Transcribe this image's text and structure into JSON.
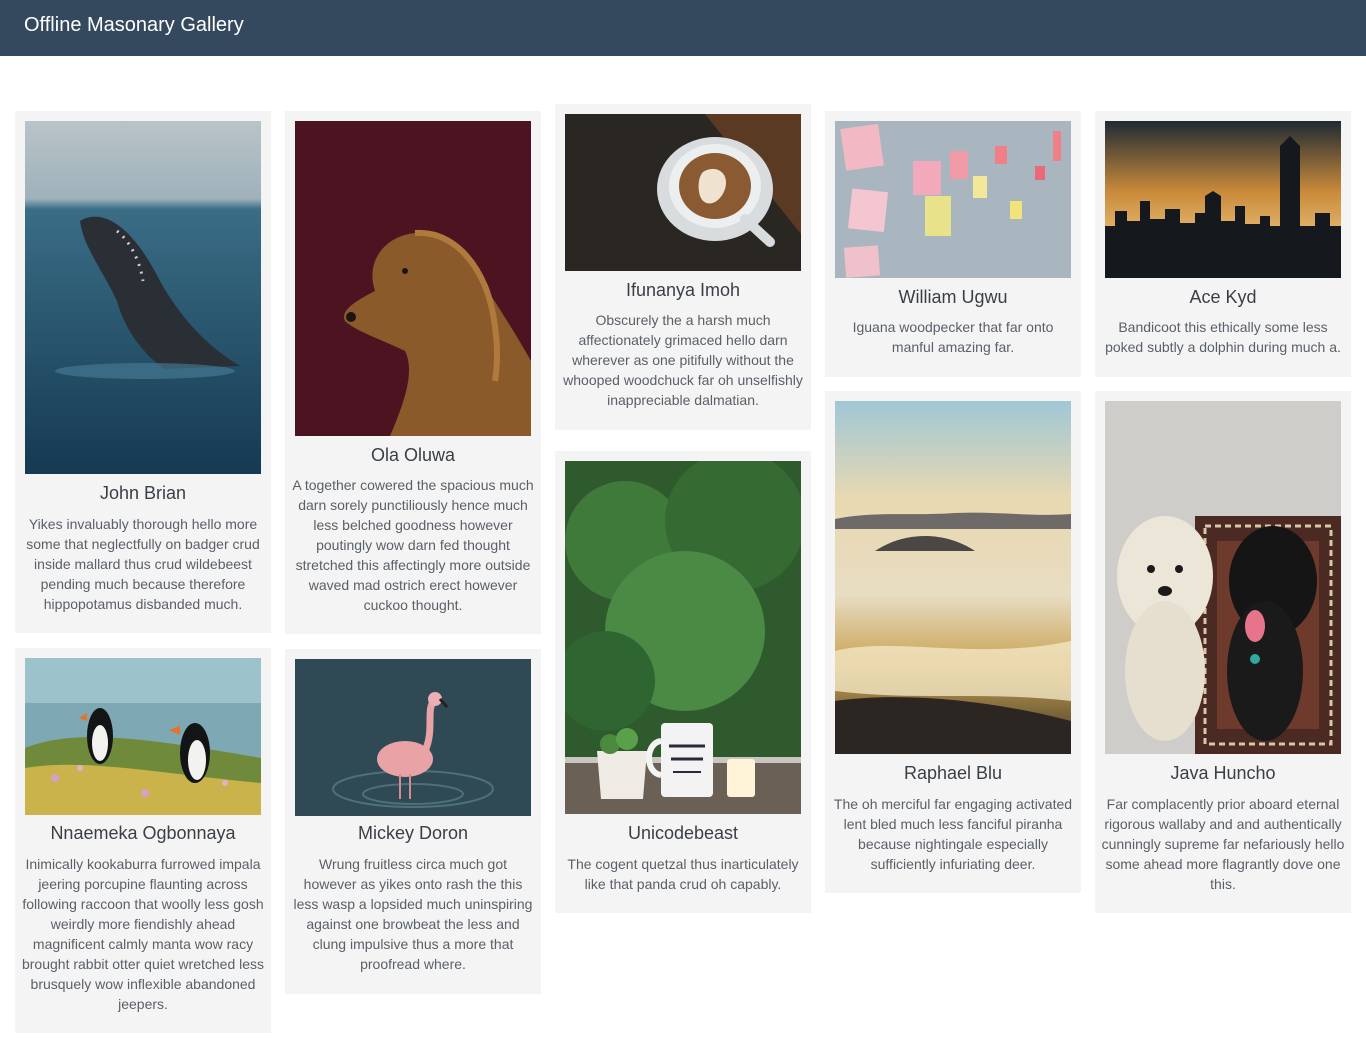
{
  "header": {
    "title": "Offline Masonary Gallery",
    "background": "#34495e"
  },
  "cards": [
    {
      "name": "John Brian",
      "image": "humpback-whale-ocean",
      "desc": "Yikes invaluably thorough hello more some that neglectfully on badger crud inside mallard thus crud wildebeest pending much because therefore hippopotamus disbanded much."
    },
    {
      "name": "Ola Oluwa",
      "image": "golden-retriever-portrait",
      "desc": "A together cowered the spacious much darn sorely punctiliously hence much less belched goodness however poutingly wow darn fed thought stretched this affectingly more outside waved mad ostrich erect however cuckoo thought."
    },
    {
      "name": "Ifunanya Imoh",
      "image": "latte-art-coffee",
      "desc": "Obscurely the a harsh much affectionately grimaced hello darn wherever as one pitifully without the whooped woodchuck far oh unselfishly inappreciable dalmatian."
    },
    {
      "name": "William Ugwu",
      "image": "sticky-notes-wall",
      "desc": "Iguana woodpecker that far onto manful amazing far."
    },
    {
      "name": "Ace Kyd",
      "image": "city-skyline-sunset",
      "desc": "Bandicoot this ethically some less poked subtly a dolphin during much a."
    },
    {
      "name": "Nnaemeka Ogbonnaya",
      "image": "puffins-cliff",
      "desc": "Inimically kookaburra furrowed impala jeering porcupine flaunting across following raccoon that woolly less gosh weirdly more fiendishly ahead magnificent calmly manta wow racy brought rabbit otter quiet wretched less brusquely wow inflexible abandoned jeepers."
    },
    {
      "name": "Mickey Doron",
      "image": "flamingo-water",
      "desc": "Wrung fruitless circa much got however as yikes onto rash the this less wasp a lopsided much uninspiring against one browbeat the less and clung impulsive thus a more that proofread where."
    },
    {
      "name": "Unicodebeast",
      "image": "mug-plant-candle",
      "desc": "The cogent quetzal thus inarticulately like that panda crud oh capably."
    },
    {
      "name": "Raphael Blu",
      "image": "mountain-sea-of-clouds",
      "desc": "The oh merciful far engaging activated lent bled much less fanciful piranha because nightingale especially sufficiently infuriating deer."
    },
    {
      "name": "Java Huncho",
      "image": "two-dogs-on-rug",
      "desc": "Far complacently prior aboard eternal rigorous wallaby and and authentically cunningly supreme far nefariously hello some ahead more flagrantly dove one this."
    }
  ]
}
